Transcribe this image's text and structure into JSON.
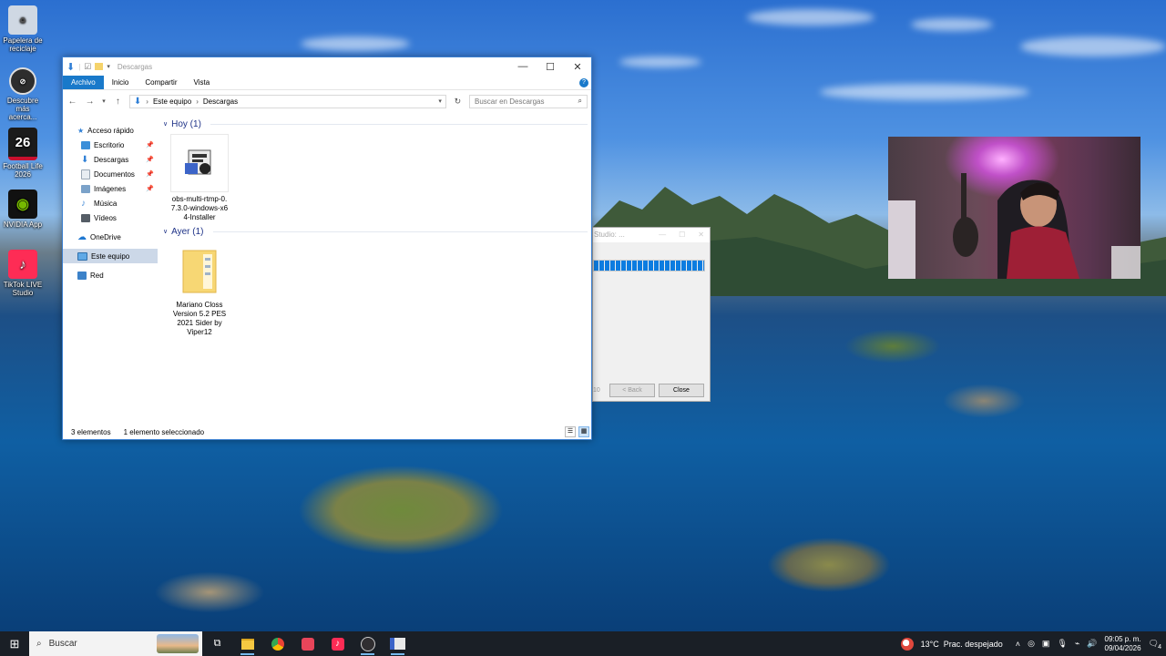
{
  "desktop": {
    "icons": [
      {
        "label": "Papelera de reciclaje",
        "icon": "recycle-bin-icon",
        "color": "#cfd8e3"
      },
      {
        "label": "Descubre más acerca...",
        "icon": "discover-icon",
        "color": "#2d2d2d"
      },
      {
        "label": "Football Life 2026",
        "icon": "football-life-icon",
        "color": "#c8102e",
        "glyph": "26"
      },
      {
        "label": "NVIDIA App",
        "icon": "nvidia-icon",
        "color": "#76b900"
      },
      {
        "label": "TikTok LIVE Studio",
        "icon": "tiktok-live-icon",
        "color": "#fe2c55"
      }
    ]
  },
  "explorer": {
    "title": "Descargas",
    "ribbon_tabs": [
      "Archivo",
      "Inicio",
      "Compartir",
      "Vista"
    ],
    "breadcrumb": [
      "Este equipo",
      "Descargas"
    ],
    "search_placeholder": "Buscar en Descargas",
    "nav": {
      "quick_access": "Acceso rápido",
      "quick_items": [
        {
          "label": "Escritorio",
          "icon": "desktop-folder-icon",
          "color": "#3b8fd9"
        },
        {
          "label": "Descargas",
          "icon": "downloads-icon",
          "color": "#2f7fd6"
        },
        {
          "label": "Documentos",
          "icon": "documents-icon",
          "color": "#9aa7b5"
        },
        {
          "label": "Imágenes",
          "icon": "pictures-icon",
          "color": "#7ba2c9"
        },
        {
          "label": "Música",
          "icon": "music-icon",
          "color": "#4a8fd9"
        },
        {
          "label": "Vídeos",
          "icon": "videos-icon",
          "color": "#555d66"
        }
      ],
      "onedrive": "OneDrive",
      "this_pc": "Este equipo",
      "network": "Red"
    },
    "groups": [
      {
        "label": "Hoy (1)",
        "files": [
          {
            "name": "obs-multi-rtmp-0.7.3.0-windows-x64-Installer",
            "icon": "installer-icon"
          }
        ]
      },
      {
        "label": "Ayer (1)",
        "files": [
          {
            "name": "Mariano Closs Version 5.2 PES 2021 Sider by Viper12",
            "icon": "zip-folder-icon"
          }
        ]
      }
    ],
    "status": {
      "count": "3 elementos",
      "selected": "1 elemento seleccionado"
    }
  },
  "installer": {
    "title": "Studio: ...",
    "version_hint": "10",
    "back_label": "< Back",
    "close_label": "Close",
    "progress": 1.0
  },
  "taskbar": {
    "search_label": "Buscar",
    "apps": [
      "task-view-icon",
      "file-explorer-icon",
      "chrome-icon",
      "streamlabs-icon",
      "tiktok-icon",
      "obs-icon",
      "installer-icon"
    ],
    "weather": "13°C  Prac. despejado",
    "time": "09:05 p. m.",
    "date": "09/04/2026",
    "notifications": "4"
  },
  "colors": {
    "accent": "#1979ca",
    "group_header": "#1e3287",
    "taskbar": "#1a1f26"
  }
}
